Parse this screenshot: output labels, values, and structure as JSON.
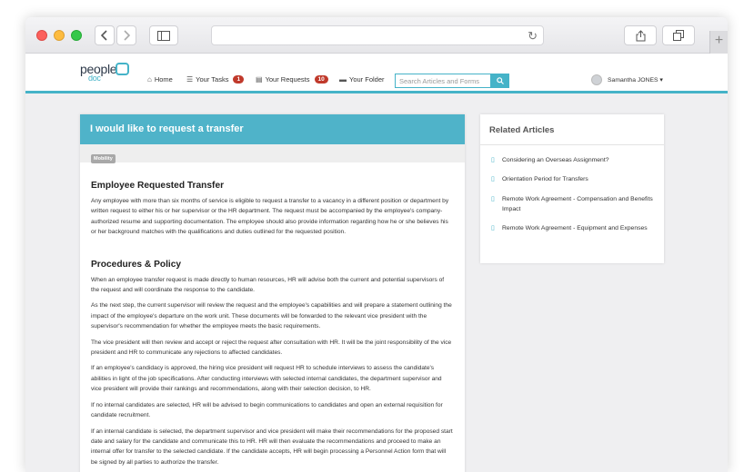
{
  "browser": {
    "back_icon": "chevron-left-icon",
    "forward_icon": "chevron-right-icon",
    "sidebar_icon": "sidebar-icon",
    "reload_icon": "reload-icon",
    "share_icon": "share-icon",
    "tabs_icon": "tabs-icon",
    "new_tab": "+"
  },
  "nav": {
    "logo_top": "people",
    "logo_bottom": "doc",
    "home": "Home",
    "tasks": "Your Tasks",
    "tasks_count": "1",
    "requests": "Your Requests",
    "requests_count": "10",
    "folder": "Your Folder",
    "search_placeholder": "Search Articles and Forms",
    "user": "Samantha JONES ▾",
    "accent": "#45b3c8",
    "badge_color": "#c0392b"
  },
  "article": {
    "title": "I would like to request a transfer",
    "tag": "Mobility",
    "section1_title": "Employee Requested Transfer",
    "section1_para": "Any employee with more than six months of service is eligible to request a transfer to a vacancy in a different position or department by written request to either his or her supervisor or the HR department. The request must be accompanied by the employee's company-authorized resume and supporting documentation. The employee should also provide information regarding how he or she believes his or her background matches with the qualifications and duties outlined for the requested position.",
    "section2_title": "Procedures & Policy",
    "paras": [
      "When an employee transfer request is made directly to human resources, HR will advise both the current and potential supervisors of the request and will coordinate the response to the candidate.",
      "As the next step, the current supervisor will review the request and the employee's capabilities and  will prepare a statement outlining the impact of the employee's departure on the work unit. These documents will be forwarded to the relevant vice president with the supervisor's recommendation for whether the employee meets the basic requirements.",
      "The vice president will then review and accept or reject the request after consultation with HR. It will be the joint responsibility of the vice president and HR to communicate any rejections to affected candidates.",
      "If an employee's candidacy is approved, the hiring vice president will request HR to schedule interviews to assess the candidate's abilities in light of the job specifications. After conducting interviews with selected internal candidates, the department supervisor and vice president will provide their rankings and recommendations, along with their selection decision, to HR.",
      "If no internal candidates are selected, HR will be advised to begin communications to candidates and open an external requisition for candidate recruitment.",
      "If an internal candidate is selected, the department supervisor and vice president will make their recommendations for the proposed start date and salary for the candidate and communicate this to HR. HR will then evaluate the recommendations and proceed to make an internal offer for transfer to the selected candidate. If the candidate accepts, HR will begin processing a Personnel Action form that will be signed by all parties to authorize the transfer."
    ]
  },
  "related": {
    "title": "Related Articles",
    "items": [
      "Considering an Overseas Assignment?",
      "Orientation Period for Transfers",
      "Remote Work Agreement - Compensation and Benefits Impact",
      "Remote Work Agreement - Equipment and Expenses"
    ]
  }
}
